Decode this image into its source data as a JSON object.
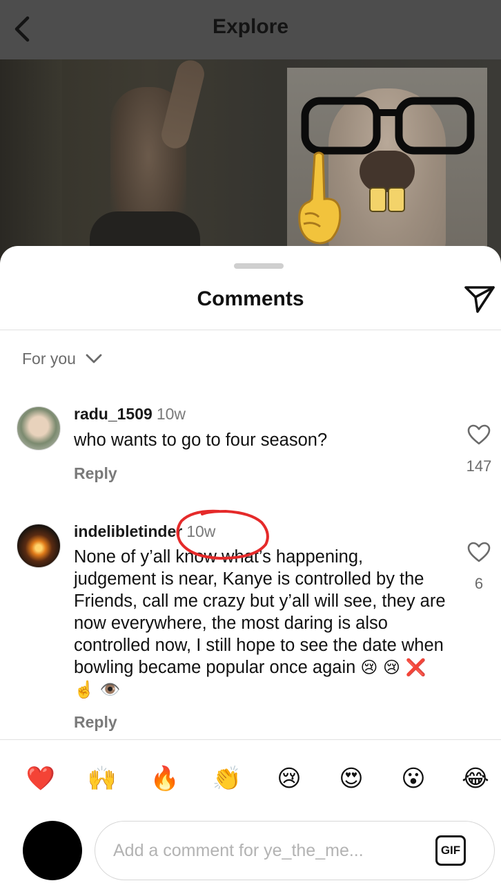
{
  "nav": {
    "title": "Explore"
  },
  "sheet": {
    "title": "Comments",
    "sort_label": "For you"
  },
  "comments": [
    {
      "username": "radu_1509",
      "time": "10w",
      "text": "who wants to go to four season?",
      "reply_label": "Reply",
      "likes": "147",
      "avatar_icon": "child-photo-avatar"
    },
    {
      "username": "indelibletinder",
      "time": "10w",
      "text": "None of y’all know what’s happening, judgement is near, Kanye is controlled by the Friends, call me crazy but y’all will see, they are now everywhere, the most daring is also controlled now, I still hope to see the date when bowling became popular once again",
      "emoji_tail": "😢 😢 ❌ ☝️ 👁️",
      "reply_label": "Reply",
      "likes": "6",
      "avatar_icon": "campfire-photo-avatar",
      "annotation": "red-hand-drawn-circle-around-timestamp"
    }
  ],
  "reactions": [
    "❤️",
    "🙌",
    "🔥",
    "👏",
    "😢",
    "😍",
    "😮",
    "😂"
  ],
  "composer": {
    "placeholder": "Add a comment for ye_the_me...",
    "gif_label": "GIF"
  },
  "colors": {
    "nav_bg": "#4d4d4d",
    "annotation_red": "#e52a2a",
    "muted_text": "#7a7a7a"
  }
}
